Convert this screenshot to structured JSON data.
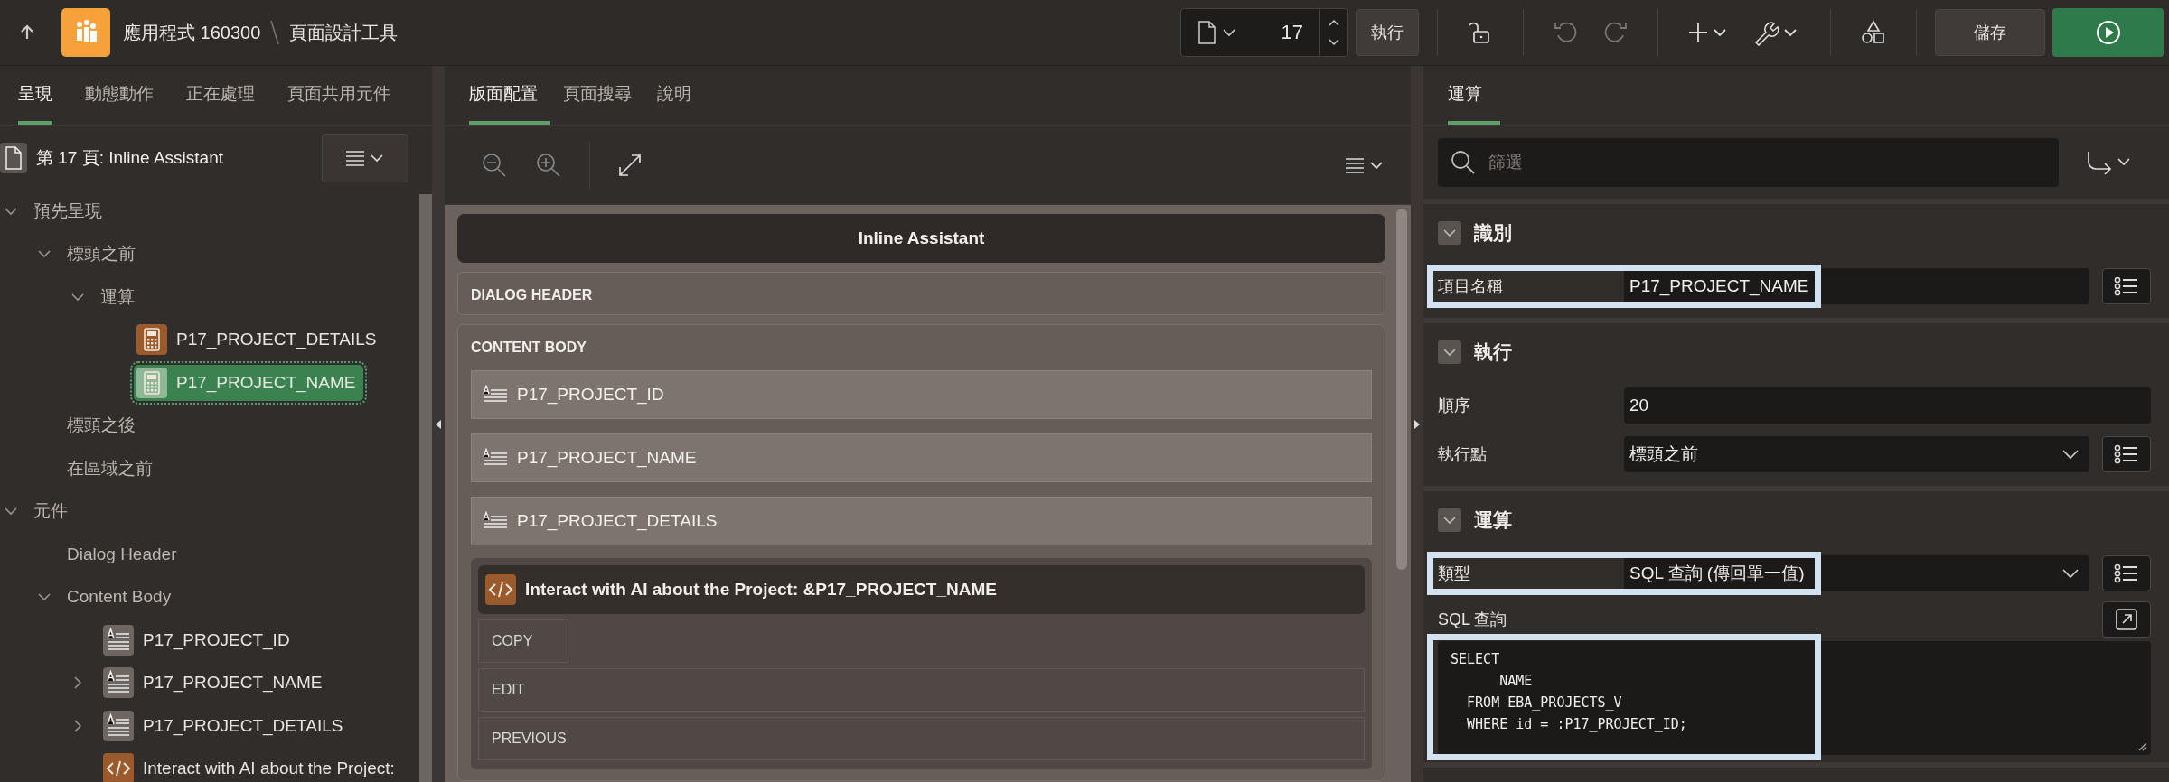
{
  "topbar": {
    "app_name": "應用程式 160300",
    "page_title": "頁面設計工具",
    "page_number": "17",
    "run_label": "執行",
    "save_label": "儲存"
  },
  "left": {
    "tabs": [
      {
        "label": "呈現",
        "selected": true
      },
      {
        "label": "動態動作",
        "selected": false
      },
      {
        "label": "正在處理",
        "selected": false
      },
      {
        "label": "頁面共用元件",
        "selected": false
      }
    ],
    "page_heading": "第 17 頁: Inline Assistant",
    "tree": [
      {
        "label": "預先呈現",
        "kind": "folder",
        "expanded": true,
        "children": [
          {
            "label": "標頭之前",
            "kind": "folder",
            "expanded": true,
            "children": [
              {
                "label": "運算",
                "kind": "folder",
                "expanded": true,
                "children": [
                  {
                    "label": "P17_PROJECT_DETAILS",
                    "kind": "computation",
                    "selected": false
                  },
                  {
                    "label": "P17_PROJECT_NAME",
                    "kind": "computation",
                    "selected": true
                  }
                ]
              }
            ]
          },
          {
            "label": "標頭之後",
            "kind": "folder"
          },
          {
            "label": "在區域之前",
            "kind": "folder"
          }
        ]
      },
      {
        "label": "元件",
        "kind": "folder",
        "expanded": true,
        "children": [
          {
            "label": "Dialog Header",
            "kind": "folder"
          },
          {
            "label": "Content Body",
            "kind": "folder",
            "expanded": true,
            "children": [
              {
                "label": "P17_PROJECT_ID",
                "kind": "item",
                "selected": false
              },
              {
                "label": "P17_PROJECT_NAME",
                "kind": "item",
                "expanded": false,
                "selected": false
              },
              {
                "label": "P17_PROJECT_DETAILS",
                "kind": "item",
                "expanded": false,
                "selected": false
              },
              {
                "label": "Interact with AI about the Project:",
                "kind": "code",
                "selected": false
              }
            ]
          }
        ]
      }
    ]
  },
  "middle": {
    "tabs": [
      {
        "label": "版面配置",
        "selected": true
      },
      {
        "label": "頁面搜尋",
        "selected": false
      },
      {
        "label": "說明",
        "selected": false
      }
    ],
    "dialog_title": "Inline Assistant",
    "regions": [
      {
        "label": "DIALOG HEADER"
      },
      {
        "label": "CONTENT BODY",
        "items": [
          {
            "label": "P17_PROJECT_ID"
          },
          {
            "label": "P17_PROJECT_NAME"
          },
          {
            "label": "P17_PROJECT_DETAILS"
          }
        ],
        "sub_region": {
          "title": "Interact with AI about the Project: &P17_PROJECT_NAME",
          "buttons": [
            {
              "label": "COPY",
              "kind": "button"
            },
            {
              "label": "EDIT",
              "kind": "bar"
            },
            {
              "label": "PREVIOUS",
              "kind": "bar"
            }
          ]
        }
      }
    ]
  },
  "right": {
    "tabs": [
      {
        "label": "運算",
        "selected": true
      }
    ],
    "filter_placeholder": "篩選",
    "sections": [
      {
        "title": "識別",
        "expanded": true,
        "fields": [
          {
            "label": "項目名稱",
            "kind": "text",
            "value": "P17_PROJECT_NAME",
            "highlighted": true,
            "list_button": true
          }
        ]
      },
      {
        "title": "執行",
        "expanded": true,
        "fields": [
          {
            "label": "順序",
            "kind": "text",
            "value": "20",
            "highlighted": false,
            "list_button": false
          },
          {
            "label": "執行點",
            "kind": "select",
            "value": "標頭之前",
            "highlighted": false,
            "list_button": true
          }
        ]
      },
      {
        "title": "運算",
        "expanded": true,
        "fields": [
          {
            "label": "類型",
            "kind": "select",
            "value": "SQL 查詢 (傳回單一值)",
            "highlighted": true,
            "list_button": true
          },
          {
            "label": "SQL 查詢",
            "kind": "code",
            "lines": [
              "SELECT",
              "      NAME",
              "  FROM EBA_PROJECTS_V",
              "  WHERE id = :P17_PROJECT_ID;"
            ],
            "highlighted": true
          }
        ]
      }
    ]
  }
}
